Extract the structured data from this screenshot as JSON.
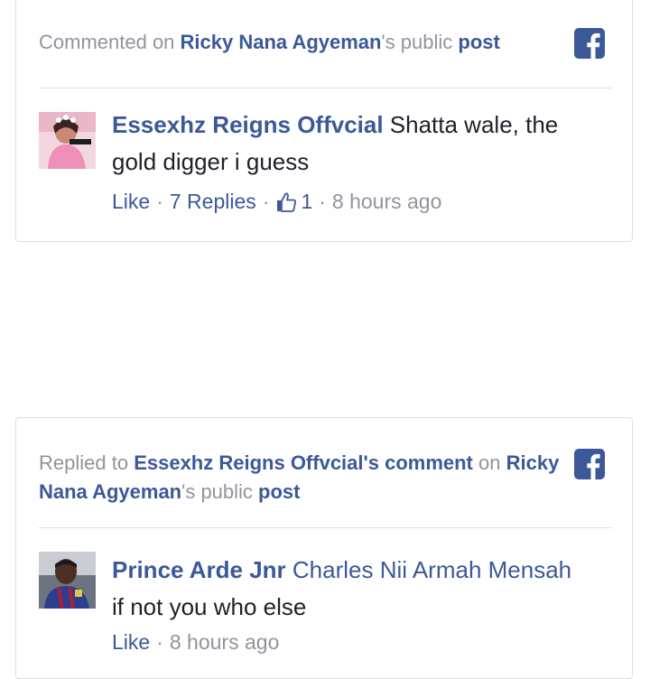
{
  "colors": {
    "brand": "#3b5998",
    "muted": "#90949c",
    "text": "#1d2129",
    "border": "#dddfe2"
  },
  "cards": [
    {
      "header": {
        "prefix": "Commented on ",
        "owner": "Ricky Nana Agyeman",
        "mid": "'s public ",
        "post": "post"
      },
      "icon": "facebook-logo-icon",
      "comment": {
        "author": "Essexhz Reigns Offvcial",
        "mention": "",
        "text": " Shatta wale, the gold digger i guess"
      },
      "actions": {
        "like": "Like",
        "replies": "7 Replies",
        "reaction_count": "1",
        "time": "8 hours ago"
      }
    },
    {
      "header": {
        "prefix": "Replied to ",
        "comment_link": "Essexhz Reigns Offvcial's comment",
        "on": " on ",
        "owner": "Ricky Nana Agyeman",
        "mid": "'s public ",
        "post": "post"
      },
      "icon": "facebook-logo-icon",
      "comment": {
        "author": "Prince Arde Jnr",
        "mention": "Charles Nii Armah Mensah",
        "text": "if not you who else"
      },
      "actions": {
        "like": "Like",
        "time": "8 hours ago"
      }
    }
  ]
}
